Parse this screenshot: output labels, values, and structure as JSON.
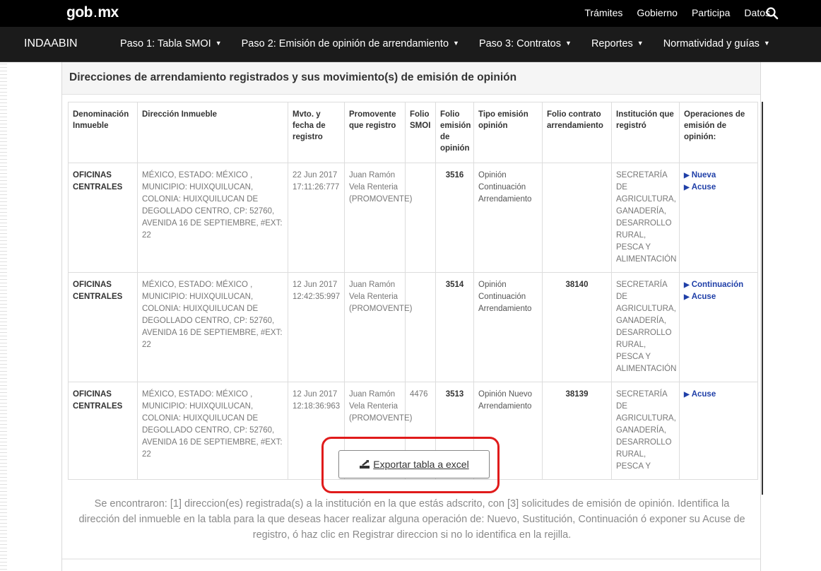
{
  "header": {
    "logo_main": "gob",
    "logo_dot": ".",
    "logo_tld": "mx",
    "links": [
      "Trámites",
      "Gobierno",
      "Participa",
      "Datos"
    ],
    "search_icon": "search-icon"
  },
  "nav": {
    "brand": "INDAABIN",
    "items": [
      "Paso 1: Tabla SMOI",
      "Paso 2: Emisión de opinión de arrendamiento",
      "Paso 3: Contratos",
      "Reportes",
      "Normatividad y guías"
    ]
  },
  "panel": {
    "title": "Direcciones de arrendamiento registrados y sus movimiento(s) de emisión de opinión"
  },
  "table": {
    "headers": [
      "Denominación Inmueble",
      "Dirección Inmueble",
      "Mvto. y fecha de registro",
      "Promovente que registro",
      "Folio SMOI",
      "Folio emisión de opinión",
      "Tipo emisión opinión",
      "Folio contrato arrendamiento",
      "Institución que registró",
      "Operaciones de emisión de opinión:"
    ],
    "rows": [
      {
        "name": "OFICINAS CENTRALES",
        "address": "MÉXICO, ESTADO: MÉXICO , MUNICIPIO: HUIXQUILUCAN, COLONIA: HUIXQUILUCAN DE DEGOLLADO CENTRO, CP: 52760, AVENIDA 16 DE SEPTIEMBRE, #EXT: 22",
        "date": "22 Jun 2017 17:11:26:777",
        "promovente": "Juan Ramón Vela Renteria (PROMOVENTE)",
        "folio_smoi": "",
        "folio_opinion": "3516",
        "tipo": "Opinión Continuación Arrendamiento",
        "folio_contrato": "",
        "institucion": "SECRETARÍA DE AGRICULTURA, GANADERÍA, DESARROLLO RURAL, PESCA Y ALIMENTACIÓN",
        "ops": [
          "Nueva",
          "Acuse"
        ]
      },
      {
        "name": "OFICINAS CENTRALES",
        "address": "MÉXICO, ESTADO: MÉXICO , MUNICIPIO: HUIXQUILUCAN, COLONIA: HUIXQUILUCAN DE DEGOLLADO CENTRO, CP: 52760, AVENIDA 16 DE SEPTIEMBRE, #EXT: 22",
        "date": "12 Jun 2017 12:42:35:997",
        "promovente": "Juan Ramón Vela Renteria (PROMOVENTE)",
        "folio_smoi": "",
        "folio_opinion": "3514",
        "tipo": "Opinión Continuación Arrendamiento",
        "folio_contrato": "38140",
        "institucion": "SECRETARÍA DE AGRICULTURA, GANADERÍA, DESARROLLO RURAL, PESCA Y ALIMENTACIÓN",
        "ops": [
          "Continuación",
          "Acuse"
        ]
      },
      {
        "name": "OFICINAS CENTRALES",
        "address": "MÉXICO, ESTADO: MÉXICO , MUNICIPIO: HUIXQUILUCAN, COLONIA: HUIXQUILUCAN DE DEGOLLADO CENTRO, CP: 52760, AVENIDA 16 DE SEPTIEMBRE, #EXT: 22",
        "date": "12 Jun 2017 12:18:36:963",
        "promovente": "Juan Ramón Vela Renteria (PROMOVENTE)",
        "folio_smoi": "4476",
        "folio_opinion": "3513",
        "tipo": "Opinión Nuevo Arrendamiento",
        "folio_contrato": "38139",
        "institucion": "SECRETARÍA DE AGRICULTURA, GANADERÍA, DESARROLLO RURAL, PESCA Y",
        "ops": [
          "Acuse"
        ]
      }
    ]
  },
  "export": {
    "label": " Exportar tabla a excel",
    "icon": "export-icon",
    "highlight_color": "#e01b1b"
  },
  "info_text": "Se encontraron: [1] direccion(es) registrada(s) a la institución en la que estás adscrito, con [3] solicitudes de emisión de opinión. Identifica la dirección del inmueble en la tabla para la que deseas hacer realizar alguna operación de: Nuevo, Sustitución, Continuación ó exponer su Acuse de registro, ó haz clic en Registrar direccion si no lo identifica en la rejilla.",
  "colors": {
    "topbar": "#000000",
    "navbar": "#1b1b1b",
    "link": "#1f3fa8"
  }
}
